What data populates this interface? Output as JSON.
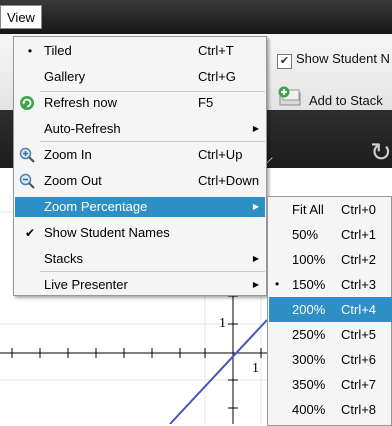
{
  "menubar": {
    "view_label": "View"
  },
  "toolbar": {
    "show_student_names_label": "Show Student N",
    "add_to_stack_label": "Add to Stack"
  },
  "darkbar": {
    "partial_text": "d"
  },
  "graph": {
    "y_tick_label": "1",
    "x_tick_label": "1"
  },
  "view_menu": {
    "items": [
      {
        "label": "Tiled",
        "shortcut": "Ctrl+T",
        "mark": "•"
      },
      {
        "label": "Gallery",
        "shortcut": "Ctrl+G"
      },
      {
        "label": "Refresh now",
        "shortcut": "F5",
        "icon": "refresh-icon"
      },
      {
        "label": "Auto-Refresh",
        "submenu": true
      },
      {
        "label": "Zoom In",
        "shortcut": "Ctrl+Up",
        "icon": "zoom-in-icon"
      },
      {
        "label": "Zoom Out",
        "shortcut": "Ctrl+Down",
        "icon": "zoom-out-icon"
      },
      {
        "label": "Zoom Percentage",
        "submenu": true,
        "highlighted": true
      },
      {
        "label": "Show Student Names",
        "mark": "✔"
      },
      {
        "label": "Stacks",
        "submenu": true
      },
      {
        "label": "Live Presenter",
        "submenu": true
      }
    ]
  },
  "zoom_submenu": {
    "items": [
      {
        "label": "Fit All",
        "shortcut": "Ctrl+0"
      },
      {
        "label": "50%",
        "shortcut": "Ctrl+1"
      },
      {
        "label": "100%",
        "shortcut": "Ctrl+2"
      },
      {
        "label": "150%",
        "shortcut": "Ctrl+3",
        "mark": "•"
      },
      {
        "label": "200%",
        "shortcut": "Ctrl+4",
        "highlighted": true
      },
      {
        "label": "250%",
        "shortcut": "Ctrl+5"
      },
      {
        "label": "300%",
        "shortcut": "Ctrl+6"
      },
      {
        "label": "350%",
        "shortcut": "Ctrl+7"
      },
      {
        "label": "400%",
        "shortcut": "Ctrl+8"
      }
    ]
  },
  "colors": {
    "highlight": "#2d8fc4",
    "menu_bg": "#f5f5f5",
    "graph_line": "#4a55b8"
  }
}
